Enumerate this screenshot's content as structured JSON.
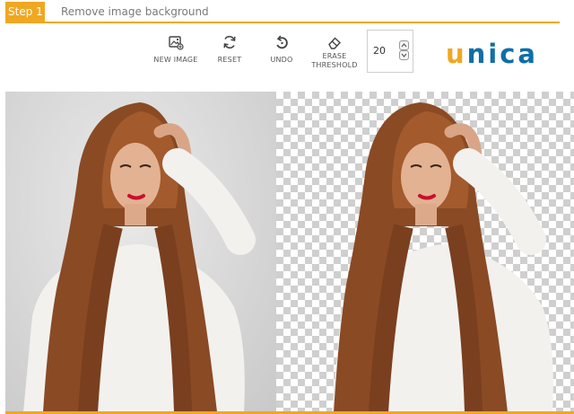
{
  "step": {
    "badge": "Step 1",
    "title": "Remove image background"
  },
  "toolbar": {
    "new_image": {
      "label": "NEW IMAGE",
      "icon": "new-image-icon"
    },
    "reset": {
      "label": "RESET",
      "icon": "reset-icon"
    },
    "undo": {
      "label": "UNDO",
      "icon": "undo-icon"
    },
    "erase_threshold": {
      "label_line1": "ERASE",
      "label_line2": "THRESHOLD",
      "icon": "eraser-icon"
    },
    "threshold_value": "20"
  },
  "logo": {
    "first_letter": "u",
    "rest": "nica",
    "accent_color": "#f0a722",
    "brand_color": "#0f6fa8"
  },
  "canvas": {
    "original_label": "original photo",
    "result_label": "background removed result"
  },
  "colors": {
    "accent": "#f0a722"
  }
}
